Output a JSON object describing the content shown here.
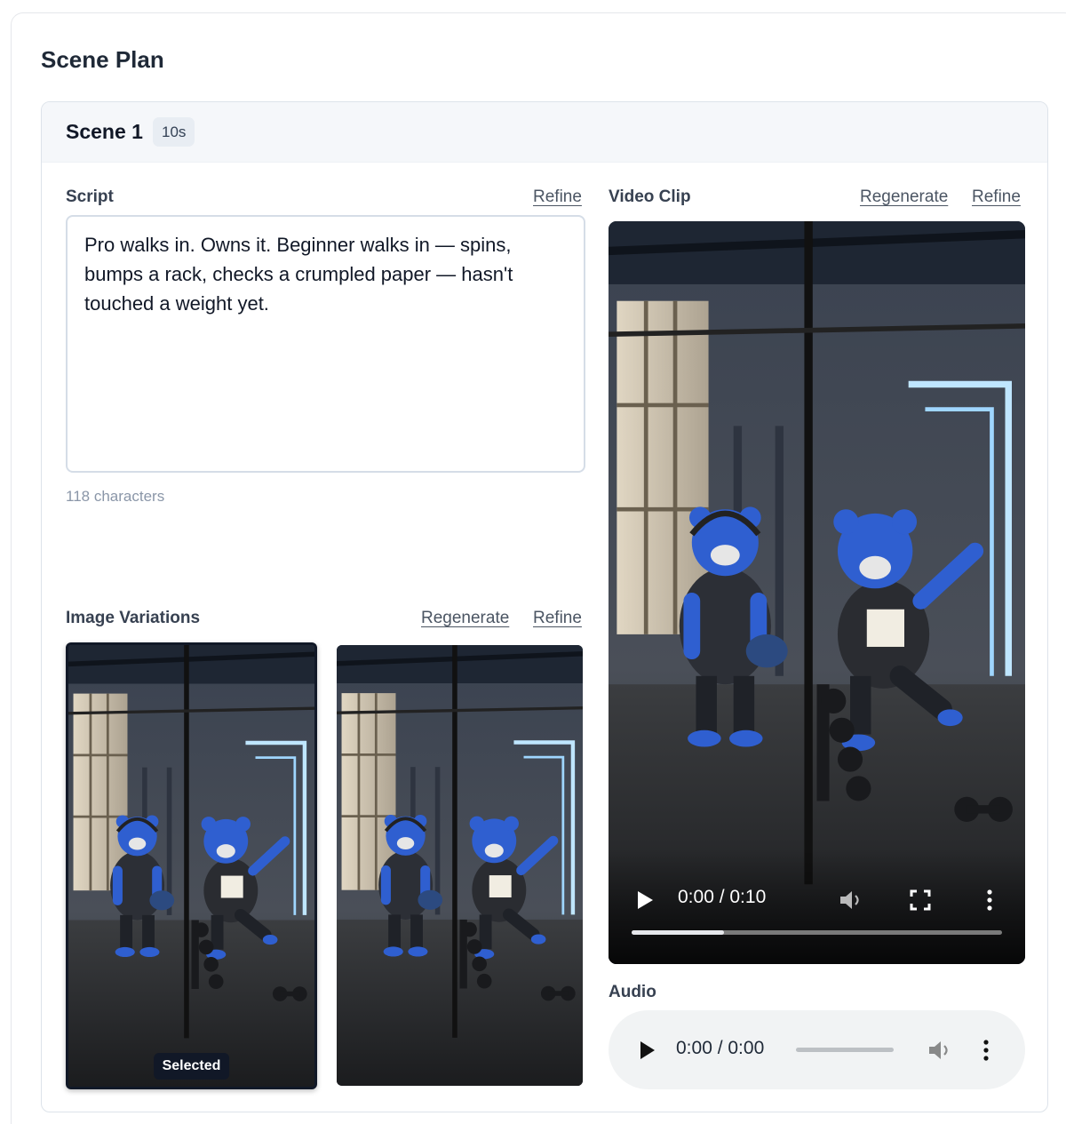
{
  "page": {
    "title": "Scene Plan"
  },
  "scene": {
    "name": "Scene 1",
    "duration": "10s",
    "script": {
      "label": "Script",
      "refine_label": "Refine",
      "text": "Pro walks in. Owns it. Beginner walks in — spins, bumps a rack, checks a crumpled paper — hasn't touched a weight yet.",
      "char_count": "118 characters"
    },
    "images": {
      "label": "Image Variations",
      "regenerate_label": "Regenerate",
      "refine_label": "Refine",
      "selected_label": "Selected",
      "selected_index": 0,
      "count": 2
    },
    "video": {
      "label": "Video Clip",
      "regenerate_label": "Regenerate",
      "refine_label": "Refine",
      "time": "0:00 / 0:10",
      "progress_fraction": 0.25
    },
    "audio": {
      "label": "Audio",
      "time": "0:00 / 0:00"
    }
  },
  "colors": {
    "text_primary": "#111827",
    "link": "#4b5563",
    "border": "#d5dde7",
    "bear_blue": "#2f5fd0",
    "neon": "#bfe6ff"
  }
}
